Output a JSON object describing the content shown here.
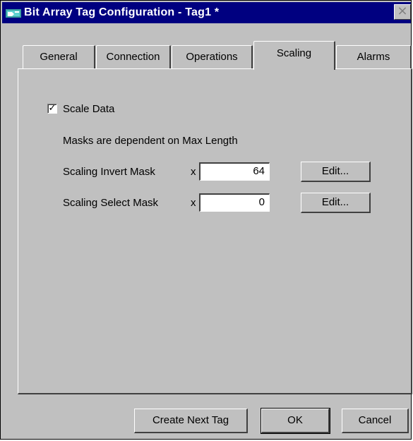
{
  "window": {
    "title": "Bit Array Tag Configuration - Tag1 *",
    "close_glyph": "×"
  },
  "tabs": [
    {
      "label": "General",
      "active": false
    },
    {
      "label": "Connection",
      "active": false
    },
    {
      "label": "Operations",
      "active": false
    },
    {
      "label": "Scaling",
      "active": true
    },
    {
      "label": "Alarms",
      "active": false
    }
  ],
  "scaling": {
    "scale_data_label": "Scale Data",
    "scale_data_checked": true,
    "check_glyph": "✓",
    "note": "Masks are dependent on Max Length",
    "invert_mask": {
      "label": "Scaling Invert Mask",
      "prefix": "x",
      "value": "64",
      "edit_label": "Edit..."
    },
    "select_mask": {
      "label": "Scaling Select Mask",
      "prefix": "x",
      "value": "0",
      "edit_label": "Edit..."
    }
  },
  "footer": {
    "create_next_label": "Create Next Tag",
    "ok_label": "OK",
    "cancel_label": "Cancel"
  },
  "colors": {
    "titlebar": "#000080",
    "face": "#c0c0c0"
  }
}
